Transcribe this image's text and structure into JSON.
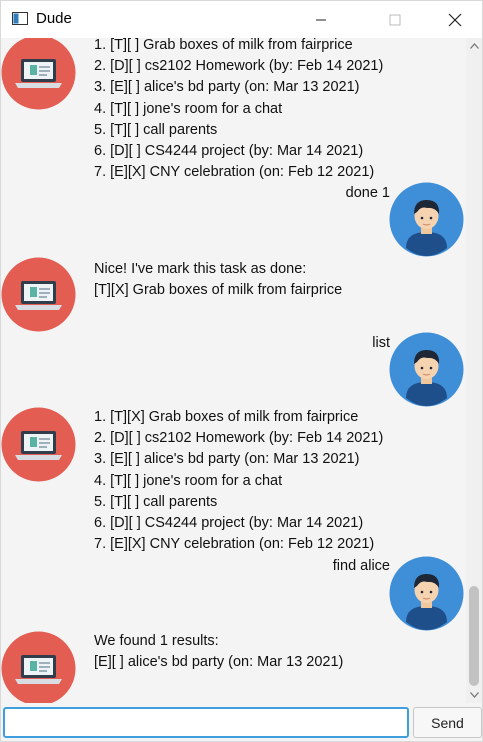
{
  "window": {
    "title": "Dude"
  },
  "colors": {
    "bot_avatar_bg": "#e35d52",
    "user_avatar_bg": "#3f8fd8",
    "accent": "#3f9fdc"
  },
  "messages": [
    {
      "sender": "bot",
      "lines": [
        "1. [T][ ] Grab boxes of milk from fairprice",
        "2. [D][ ] cs2102 Homework (by: Feb 14 2021)",
        "3. [E][ ] alice's bd party (on: Mar 13 2021)",
        "4. [T][ ] jone's room for a chat",
        "5. [T][ ] call parents",
        "6. [D][ ] CS4244 project (by: Mar 14 2021)",
        "7. [E][X] CNY celebration (on: Feb 12 2021)"
      ]
    },
    {
      "sender": "user",
      "text": "done 1"
    },
    {
      "sender": "bot",
      "lines": [
        "Nice! I've mark this task as done:",
        "[T][X] Grab boxes of milk from fairprice"
      ]
    },
    {
      "sender": "user",
      "text": "list"
    },
    {
      "sender": "bot",
      "lines": [
        "1. [T][X] Grab boxes of milk from fairprice",
        "2. [D][ ] cs2102 Homework (by: Feb 14 2021)",
        "3. [E][ ] alice's bd party (on: Mar 13 2021)",
        "4. [T][ ] jone's room for a chat",
        "5. [T][ ] call parents",
        "6. [D][ ] CS4244 project (by: Mar 14 2021)",
        "7. [E][X] CNY celebration (on: Feb 12 2021)"
      ]
    },
    {
      "sender": "user",
      "text": "find alice"
    },
    {
      "sender": "bot",
      "lines": [
        "We found 1 results:",
        "[E][ ] alice's bd party (on: Mar 13 2021)"
      ]
    }
  ],
  "input": {
    "value": "",
    "placeholder": ""
  },
  "send_label": "Send"
}
